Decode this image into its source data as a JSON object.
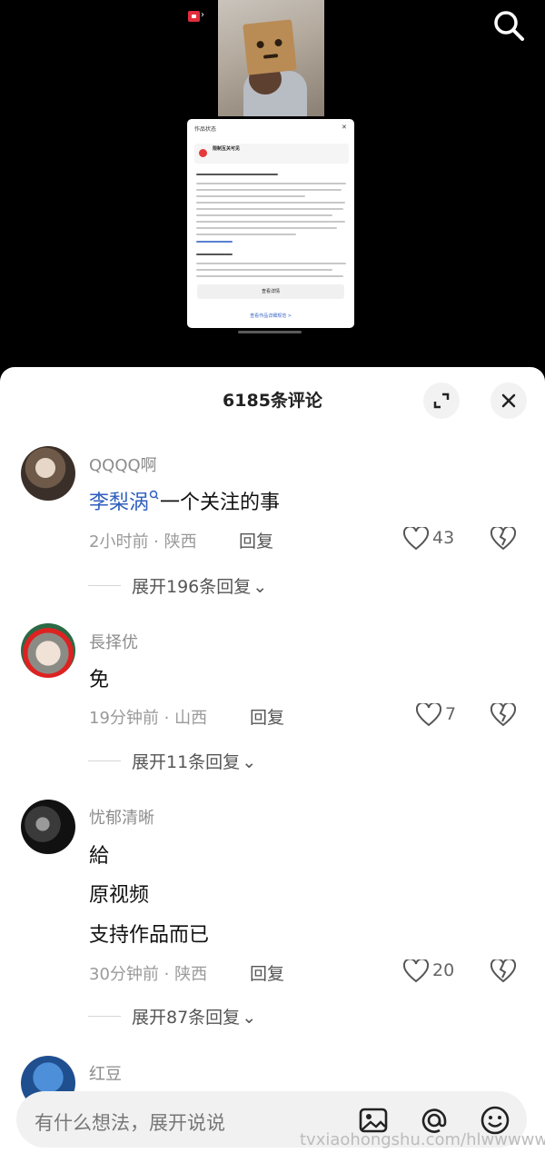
{
  "sheet": {
    "title": "6185条评论"
  },
  "comments": [
    {
      "username": "QQQQ啊",
      "lines": [
        "一个关注的事"
      ],
      "mention": "李梨涡",
      "time": "2小时前 · 陕西",
      "reply_label": "回复",
      "likes": "43",
      "expand_label": "展开196条回复"
    },
    {
      "username": "長择优",
      "lines": [
        "免"
      ],
      "time": "19分钟前 · 山西",
      "reply_label": "回复",
      "likes": "7",
      "expand_label": "展开11条回复"
    },
    {
      "username": "忧郁清晰",
      "lines": [
        "給",
        "原视频",
        "支持作品而已"
      ],
      "time": "30分钟前 · 陕西",
      "reply_label": "回复",
      "likes": "20",
      "expand_label": "展开87条回复"
    },
    {
      "username": "红豆"
    }
  ],
  "input": {
    "placeholder": "有什么想法，展开说说"
  },
  "watermark": "tvxiaohongshu.com/hlwwwww",
  "embedded_dialog": {
    "title": "作品状态",
    "warning_title": "限制互关可见",
    "action_label": "查看详情",
    "link_label": "查看作品详细规范 >"
  },
  "colors": {
    "mention": "#2f5fbf",
    "sheet_bg": "#ffffff",
    "video_bg": "#000000"
  },
  "icons": [
    "search-icon",
    "expand-icon",
    "close-icon",
    "heart-icon",
    "broken-heart-icon",
    "image-icon",
    "at-icon",
    "emoji-icon"
  ]
}
